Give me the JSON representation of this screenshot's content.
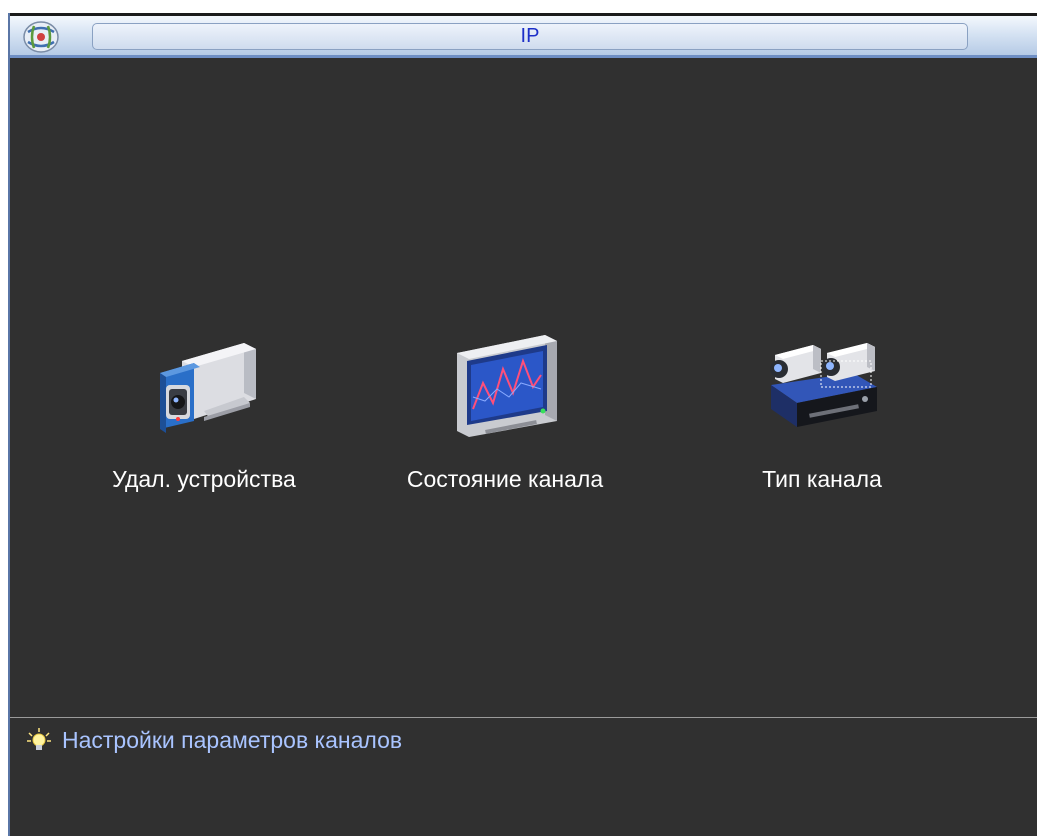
{
  "window": {
    "title": "IP",
    "icon": "app-logo-icon"
  },
  "menu": {
    "items": [
      {
        "label": "Удал. устройства",
        "icon": "remote-camera-icon"
      },
      {
        "label": "Состояние канала",
        "icon": "monitor-status-icon"
      },
      {
        "label": "Тип канала",
        "icon": "cameras-recorder-icon"
      }
    ]
  },
  "hint": {
    "icon": "lightbulb-icon",
    "text": "Настройки параметров каналов"
  },
  "colors": {
    "background": "#303030",
    "title_text": "#1d2fc8",
    "hint_text": "#a9c4ff",
    "titlebar_border": "#6f8fc4"
  }
}
